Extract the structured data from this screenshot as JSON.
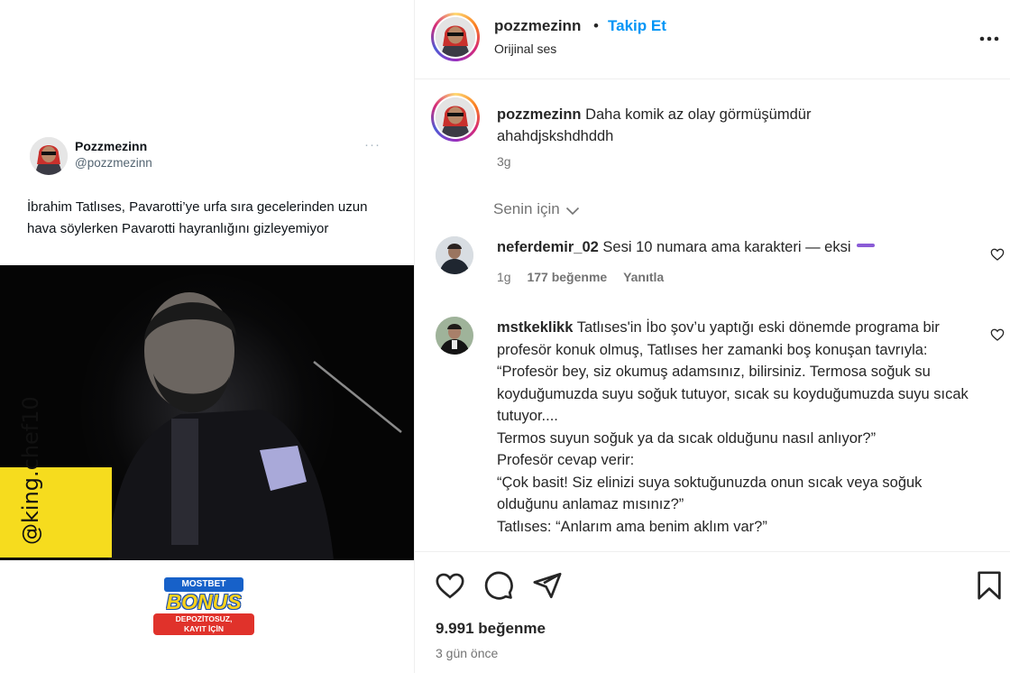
{
  "media": {
    "tweet": {
      "name": "Pozzmezinn",
      "handle": "@pozzmezinn",
      "more": "···",
      "text": "İbrahim Tatlıses, Pavarotti’ye urfa sıra gecelerinden uzun hava söylerken Pavarotti hayranlığını gizleyemiyor"
    },
    "watermark": "@king.chef10",
    "ad": {
      "top": "MOSTBET",
      "middle": "BONUS",
      "bottom_line1": "DEPOZİTOSUZ,",
      "bottom_line2": "KAYIT İÇİN"
    }
  },
  "header": {
    "username": "pozzmezinn",
    "separator": "•",
    "follow_label": "Takip Et",
    "audio": "Orijinal ses",
    "more_icon": "more-horizontal-icon"
  },
  "caption": {
    "username": "pozzmezinn",
    "text": "Daha komik az olay görmüşümdür ahahdjskshdhddh",
    "time": "3g"
  },
  "filter": {
    "label": "Senin için",
    "icon": "chevron-down-icon"
  },
  "comments": [
    {
      "username": "neferdemir_02",
      "text": "Sesi 10 numara ama karakteri — eksi",
      "time": "1g",
      "likes": "177 beğenme",
      "reply": "Yanıtla"
    },
    {
      "username": "mstkeklikk",
      "lines": [
        "Tatlıses'in İbo şov’u yaptığı eski dönemde programa bir profesör konuk olmuş, Tatlıses her zamanki boş konuşan tavrıyla:",
        "“Profesör bey, siz okumuş adamsınız, bilirsiniz. Termosa soğuk su koyduğumuzda suyu soğuk tutuyor, sıcak su koyduğumuzda suyu sıcak tutuyor....",
        "Termos suyun soğuk ya da sıcak olduğunu nasıl anlıyor?”",
        "Profesör cevap verir:",
        "“Çok basit! Siz elinizi suya soktuğunuzda onun sıcak veya soğuk olduğunu anlamaz mısınız?”",
        "Tatlıses: “Anlarım ama benim aklım var?”"
      ]
    }
  ],
  "actions": {
    "like_icon": "heart-icon",
    "comment_icon": "comment-icon",
    "share_icon": "share-icon",
    "save_icon": "bookmark-icon",
    "likes": "9.991 beğenme",
    "posted": "3 gün önce"
  },
  "colors": {
    "link": "#0095f6",
    "muted": "#737373",
    "text": "#262626",
    "watermark_bg": "#f6dc1e",
    "pill": "#8a5bd6"
  }
}
